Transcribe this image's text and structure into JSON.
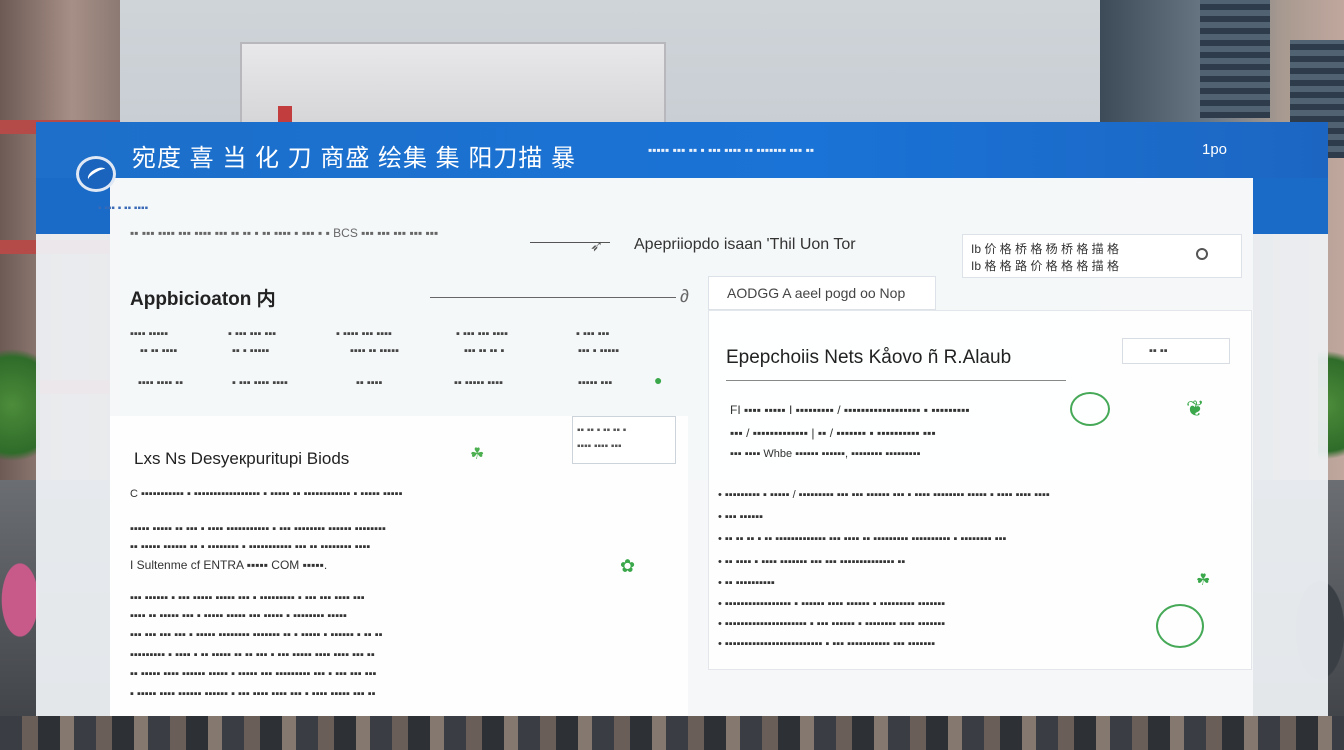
{
  "header": {
    "title": "宛度 喜 当 化 刀 商盛 绘集 集 阳刀描 暴",
    "nav": "▪▪▪▪▪ ▪▪▪ ▪▪ ▪ ▪▪▪ ▪▪▪▪ ▪▪ ▪▪▪▪▪▪▪ ▪▪▪ ▪▪",
    "page": "1po"
  },
  "breadcrumb": "▪ ▪▪▪ ▪ ▪▪ ▪▪▪▪",
  "header_line": "▪▪ ▪▪▪ ▪▪▪▪ ▪▪▪ ▪▪▪▪ ▪▪▪ ▪▪ ▪▪ ▪ ▪▪ ▪▪▪▪ ▪ ▪▪▪ ▪ ▪ BCS ▪▪▪ ▪▪▪ ▪▪▪ ▪▪▪ ▪▪▪",
  "appr": {
    "head": "Apepriiopdo isaan 'Thil Uon Tor"
  },
  "notice": {
    "line1": "Ib 价 格 桥 格 杨 桥 格 描 格",
    "line2": "Ib 格 格 路 价 格 格 格 描 格"
  },
  "application": {
    "title": "Appbicioaton 内",
    "cta": "AODGG A aeel pogd oo Nop"
  },
  "grid": {
    "row1": [
      "▪▪▪▪ ▪▪▪▪▪",
      "▪ ▪▪▪ ▪▪▪ ▪▪▪",
      "▪ ▪▪▪▪ ▪▪▪ ▪▪▪▪",
      "▪ ▪▪▪ ▪▪▪ ▪▪▪▪",
      "▪ ▪▪▪ ▪▪▪"
    ],
    "row2": [
      "▪▪ ▪▪ ▪▪▪▪",
      "▪▪ ▪ ▪▪▪▪▪",
      "▪▪▪▪ ▪▪ ▪▪▪▪▪",
      "▪▪▪ ▪▪ ▪▪ ▪",
      "▪▪▪ ▪ ▪▪▪▪▪"
    ],
    "row3": [
      "▪▪▪▪ ▪▪▪▪ ▪▪",
      "▪ ▪▪▪ ▪▪▪▪ ▪▪▪▪",
      "▪▪ ▪▪▪▪",
      "▪▪ ▪▪▪▪▪ ▪▪▪▪",
      "▪▪▪▪▪ ▪▪▪"
    ]
  },
  "left_section": {
    "title": "Lxs Ns Desyeкpuritupi Biods",
    "mini_box_line1": "▪▪ ▪▪ ▪ ▪▪ ▪▪ ▪",
    "mini_box_line2": "▪▪▪▪ ▪▪▪▪ ▪▪▪",
    "p1": "C ▪▪▪▪▪▪▪▪▪▪▪ ▪ ▪▪▪▪▪▪▪▪▪▪▪▪▪▪▪▪▪ ▪ ▪▪▪▪▪ ▪▪ ▪▪▪▪▪▪▪▪▪▪▪▪ ▪ ▪▪▪▪▪ ▪▪▪▪▪",
    "p2": "▪▪▪▪▪ ▪▪▪▪▪ ▪▪ ▪▪▪ ▪ ▪▪▪▪ ▪▪▪▪▪▪▪▪▪▪▪ ▪ ▪▪▪ ▪▪▪▪▪▪▪▪ ▪▪▪▪▪▪ ▪▪▪▪▪▪▪▪",
    "p3": "▪▪ ▪▪▪▪▪ ▪▪▪▪▪▪ ▪▪ ▪ ▪▪▪▪▪▪▪▪ ▪ ▪▪▪▪▪▪▪▪▪▪▪ ▪▪▪ ▪▪ ▪▪▪▪▪▪▪▪ ▪▪▪▪",
    "p4": "I Sultenme cf ENTRA ▪▪▪▪▪ COM ▪▪▪▪▪.",
    "p5": "▪▪▪ ▪▪▪▪▪▪ ▪ ▪▪▪ ▪▪▪▪▪ ▪▪▪▪▪ ▪▪▪ ▪ ▪▪▪▪▪▪▪▪▪ ▪ ▪▪▪ ▪▪▪ ▪▪▪▪ ▪▪▪",
    "p6": "▪▪▪▪ ▪▪ ▪▪▪▪▪ ▪▪▪ ▪ ▪▪▪▪▪ ▪▪▪▪▪ ▪▪▪ ▪▪▪▪▪ ▪ ▪▪▪▪▪▪▪▪ ▪▪▪▪▪",
    "p7": "▪▪▪ ▪▪▪ ▪▪▪ ▪▪▪ ▪ ▪▪▪▪▪ ▪▪▪▪▪▪▪▪ ▪▪▪▪▪▪▪ ▪▪ ▪ ▪▪▪▪▪ ▪ ▪▪▪▪▪▪ ▪ ▪▪ ▪▪",
    "p8": "▪▪▪▪▪▪▪▪▪ ▪ ▪▪▪▪ ▪ ▪▪ ▪▪▪▪▪ ▪▪ ▪▪ ▪▪▪ ▪ ▪▪▪ ▪▪▪▪▪ ▪▪▪▪ ▪▪▪▪ ▪▪▪ ▪▪",
    "p9": "▪▪ ▪▪▪▪▪ ▪▪▪▪ ▪▪▪▪▪▪ ▪▪▪▪▪ ▪ ▪▪▪▪▪ ▪▪▪ ▪▪▪▪▪▪▪▪▪ ▪▪▪ ▪ ▪▪▪ ▪▪▪ ▪▪▪",
    "p10": "▪ ▪▪▪▪▪ ▪▪▪▪ ▪▪▪▪▪▪ ▪▪▪▪▪▪ ▪ ▪▪▪ ▪▪▪▪ ▪▪▪▪ ▪▪▪ ▪ ▪▪▪▪ ▪▪▪▪▪ ▪▪▪ ▪▪"
  },
  "right_section": {
    "title": "Epepchoiis Nets Kåovo ñ R.Alaub",
    "button": "▪▪ ▪▪",
    "r1": "FI ▪▪▪▪ ▪▪▪▪▪ I ▪▪▪▪▪▪▪▪▪ / ▪▪▪▪▪▪▪▪▪▪▪▪▪▪▪▪▪▪ ▪ ▪▪▪▪▪▪▪▪▪",
    "r2": "▪▪▪ / ▪▪▪▪▪▪▪▪▪▪▪▪▪ | ▪▪ / ▪▪▪▪▪▪▪ ▪ ▪▪▪▪▪▪▪▪▪▪ ▪▪▪",
    "r3": "▪▪▪ ▪▪▪▪ Whbe ▪▪▪▪▪▪ ▪▪▪▪▪▪, ▪▪▪▪▪▪▪▪ ▪▪▪▪▪▪▪▪▪",
    "b1": "• ▪▪▪▪▪▪▪▪▪ ▪ ▪▪▪▪▪ / ▪▪▪▪▪▪▪▪▪ ▪▪▪ ▪▪▪ ▪▪▪▪▪▪ ▪▪▪ ▪ ▪▪▪▪ ▪▪▪▪▪▪▪▪ ▪▪▪▪▪ ▪ ▪▪▪▪ ▪▪▪▪ ▪▪▪▪",
    "b2": "• ▪▪▪ ▪▪▪▪▪▪",
    "b3": "• ▪▪ ▪▪ ▪▪ ▪ ▪▪ ▪▪▪▪▪▪▪▪▪▪▪▪▪ ▪▪▪ ▪▪▪▪ ▪▪ ▪▪▪▪▪▪▪▪▪ ▪▪▪▪▪▪▪▪▪▪ ▪ ▪▪▪▪▪▪▪▪ ▪▪▪",
    "b4": "• ▪▪ ▪▪▪▪ ▪ ▪▪▪▪ ▪▪▪▪▪▪▪ ▪▪▪ ▪▪▪ ▪▪▪▪▪▪▪▪▪▪▪▪▪▪ ▪▪",
    "b5": "• ▪▪ ▪▪▪▪▪▪▪▪▪▪",
    "b6": "• ▪▪▪▪▪▪▪▪▪▪▪▪▪▪▪▪▪ ▪ ▪▪▪▪▪▪ ▪▪▪▪ ▪▪▪▪▪▪ ▪ ▪▪▪▪▪▪▪▪▪ ▪▪▪▪▪▪▪",
    "b7": "• ▪▪▪▪▪▪▪▪▪▪▪▪▪▪▪▪▪▪▪▪▪ ▪ ▪▪▪ ▪▪▪▪▪▪ ▪ ▪▪▪▪▪▪▪▪ ▪▪▪▪ ▪▪▪▪▪▪▪",
    "b8": "• ▪▪▪▪▪▪▪▪▪▪▪▪▪▪▪▪▪▪▪▪▪▪▪▪▪ ▪ ▪▪▪ ▪▪▪▪▪▪▪▪▪▪▪ ▪▪▪ ▪▪▪▪▪▪▪"
  },
  "colors": {
    "topbar": "#1a73d6",
    "accent_green": "#3aa84a",
    "board_bg": "#eef1f4"
  }
}
